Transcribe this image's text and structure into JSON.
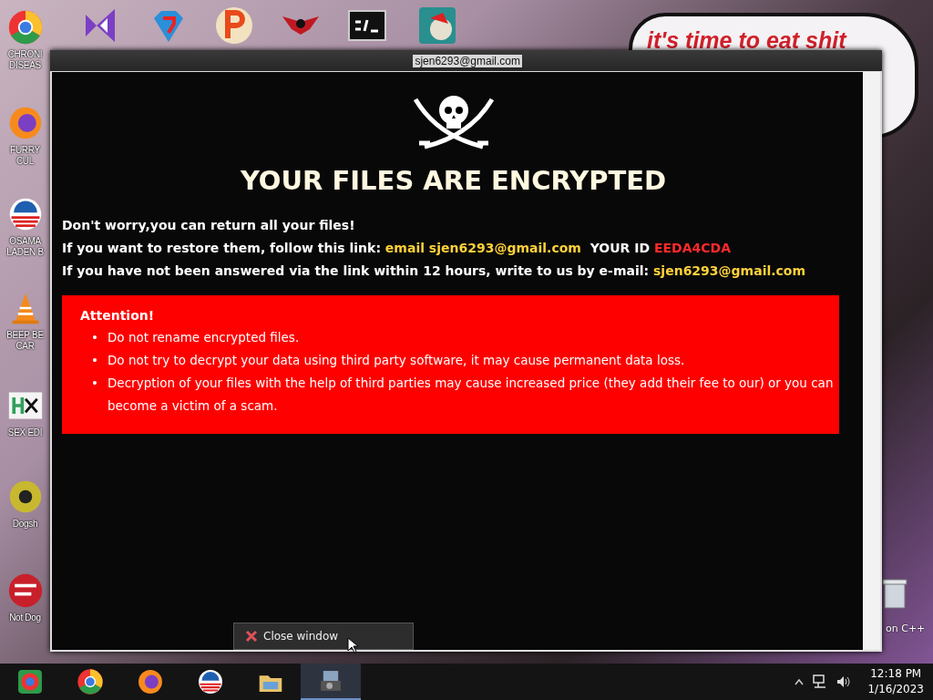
{
  "desktop": {
    "wallpaper_text": "it's time to eat shit",
    "icons": [
      {
        "kind": "ring",
        "label": "CHRONI\nDISEAS"
      },
      {
        "kind": "fox",
        "label": "FURRY CUL"
      },
      {
        "kind": "stripes",
        "label": "OSAMA\nLADEN B"
      },
      {
        "kind": "cone",
        "label": "BEEP BE\nCAR"
      },
      {
        "kind": "tile",
        "label": "SEX EDI"
      },
      {
        "kind": "disc",
        "label": "Dogsh"
      },
      {
        "kind": "badge",
        "label": "Not Dog"
      }
    ],
    "top_icons": [
      {
        "kind": "bowtie"
      },
      {
        "kind": "gem"
      },
      {
        "kind": "letter"
      },
      {
        "kind": "wings"
      },
      {
        "kind": "console"
      },
      {
        "kind": "globe"
      }
    ],
    "right_label": "on C++"
  },
  "window": {
    "title": "sjen6293@gmail.com",
    "heading": "YOUR FILES ARE ENCRYPTED",
    "lines": [
      [
        {
          "kind": "normal",
          "text": "Don't worry,you can return all your files!"
        }
      ],
      [
        {
          "kind": "normal",
          "text": "If you want to restore them, follow this link: "
        },
        {
          "kind": "highlight",
          "text": "email sjen6293@gmail.com"
        },
        {
          "kind": "normal",
          "text": "  YOUR ID "
        },
        {
          "kind": "alert",
          "text": "EEDA4CDA"
        }
      ],
      [
        {
          "kind": "normal",
          "text": "If you have not been answered via the link within 12 hours, write to us by e-mail: "
        },
        {
          "kind": "highlight",
          "text": "sjen6293@gmail.com"
        }
      ]
    ],
    "attention": {
      "title": "Attention!",
      "marker": "•",
      "items": [
        "Do not rename encrypted files.",
        "Do not try to decrypt your data using third party software, it may cause permanent data loss.",
        "Decryption of your files with the help of third parties may cause increased price (they add their fee to our) or you can become a victim of a scam."
      ]
    }
  },
  "popup": {
    "label": "Close window"
  },
  "taskbar": {
    "apps": [
      {
        "kind": "square-ring",
        "selected": false
      },
      {
        "kind": "ring",
        "selected": false
      },
      {
        "kind": "fox",
        "selected": false
      },
      {
        "kind": "stripes",
        "selected": false
      },
      {
        "kind": "folder",
        "selected": false
      },
      {
        "kind": "setup",
        "selected": true
      }
    ],
    "time": "12:18 PM",
    "date": "1/16/2023"
  }
}
